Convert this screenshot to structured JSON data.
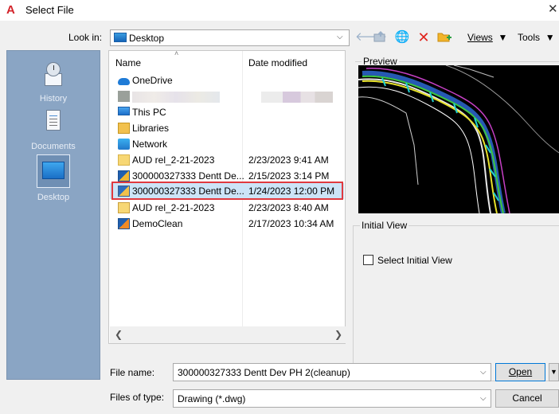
{
  "window": {
    "title": "Select File",
    "app_icon_glyph": "A",
    "close_glyph": "✕"
  },
  "lookin": {
    "label": "Look in:",
    "value": "Desktop"
  },
  "toolbar": {
    "views_label": "Views",
    "tools_label": "Tools"
  },
  "places": [
    {
      "label": "History",
      "icon": "history-icon"
    },
    {
      "label": "Documents",
      "icon": "documents-icon"
    },
    {
      "label": "Desktop",
      "icon": "desktop-icon",
      "selected": true
    }
  ],
  "filelist": {
    "columns": {
      "name": "Name",
      "date": "Date modified"
    },
    "rows": [
      {
        "name": "OneDrive",
        "date": "",
        "icon": "onedrive-icon"
      },
      {
        "name": "",
        "date": "",
        "icon": "blurred-icon",
        "blurred": true
      },
      {
        "name": "This PC",
        "date": "",
        "icon": "this-pc-icon"
      },
      {
        "name": "Libraries",
        "date": "",
        "icon": "libraries-icon"
      },
      {
        "name": "Network",
        "date": "",
        "icon": "network-icon"
      },
      {
        "name": "AUD rel_2-21-2023",
        "date": "2/23/2023 9:41 AM",
        "icon": "folder-icon"
      },
      {
        "name": "300000327333 Dentt De...",
        "date": "2/15/2023 3:14 PM",
        "icon": "dwg-file-icon"
      },
      {
        "name": "300000327333 Dentt De...",
        "date": "1/24/2023 12:00 PM",
        "icon": "dwg-file-icon",
        "selected": true
      },
      {
        "name": "AUD rel_2-21-2023",
        "date": "2/23/2023 8:40 AM",
        "icon": "zip-file-icon"
      },
      {
        "name": "DemoClean",
        "date": "2/17/2023 10:34 AM",
        "icon": "dwg-file-icon"
      }
    ]
  },
  "preview": {
    "label": "Preview"
  },
  "initial_view": {
    "label": "Initial View",
    "checkbox_label": "Select Initial View",
    "checked": false
  },
  "file_name": {
    "label": "File name:",
    "value": "300000327333 Dentt Dev PH 2(cleanup)"
  },
  "file_type": {
    "label": "Files of type:",
    "value": "Drawing (*.dwg)"
  },
  "buttons": {
    "open": "Open",
    "cancel": "Cancel"
  },
  "colors": {
    "accent": "#0078d7",
    "selection": "#cce4f7",
    "highlight_box": "#e0393e",
    "places_bg": "#8aa5c4"
  }
}
